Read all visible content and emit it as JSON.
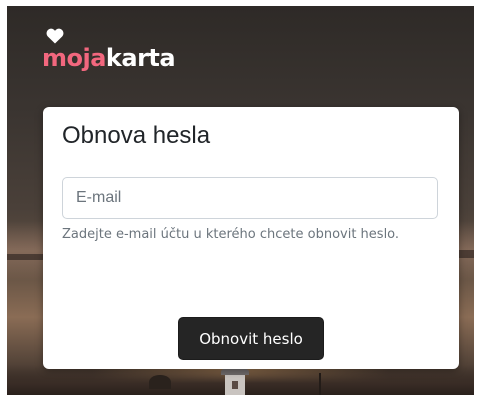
{
  "brand": {
    "name_part1": "moja",
    "name_part2": "karta",
    "icon": "heart-icon",
    "accent_color": "#f2677e",
    "secondary_color": "#ffffff"
  },
  "reset_form": {
    "title": "Obnova hesla",
    "email_field": {
      "placeholder": "E-mail",
      "value": ""
    },
    "help_text": "Zadejte e-mail účtu u kterého chcete obnovit heslo.",
    "submit_label": "Obnovit heslo"
  },
  "colors": {
    "button_background": "#252525",
    "card_background": "#ffffff",
    "help_text": "#6c757d"
  }
}
